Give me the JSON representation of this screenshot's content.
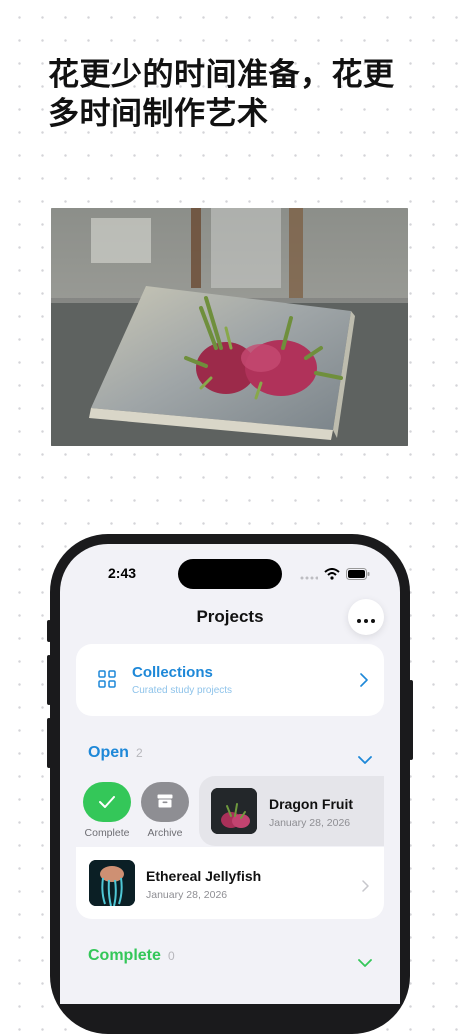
{
  "headline": "花更少的时间准备，花更多时间制作艺术",
  "status_bar": {
    "time": "2:43"
  },
  "nav": {
    "title": "Projects"
  },
  "collections": {
    "title": "Collections",
    "subtitle": "Curated study projects"
  },
  "sections": {
    "open": {
      "label": "Open",
      "count": "2"
    },
    "complete": {
      "label": "Complete",
      "count": "0"
    }
  },
  "swipe_actions": {
    "complete_label": "Complete",
    "archive_label": "Archive"
  },
  "projects": [
    {
      "title": "Dragon Fruit",
      "date": "January 28, 2026"
    },
    {
      "title": "Ethereal Jellyfish",
      "date": "January 28, 2026"
    }
  ],
  "colors": {
    "accent_blue": "#1e88d8",
    "accent_green": "#34c759",
    "archive_gray": "#8e8e93"
  },
  "icons": [
    "grid-icon",
    "chevron-right-icon",
    "chevron-down-icon",
    "ellipsis-icon",
    "checkmark-icon",
    "archive-box-icon",
    "wifi-icon",
    "battery-icon",
    "signal-icon"
  ]
}
